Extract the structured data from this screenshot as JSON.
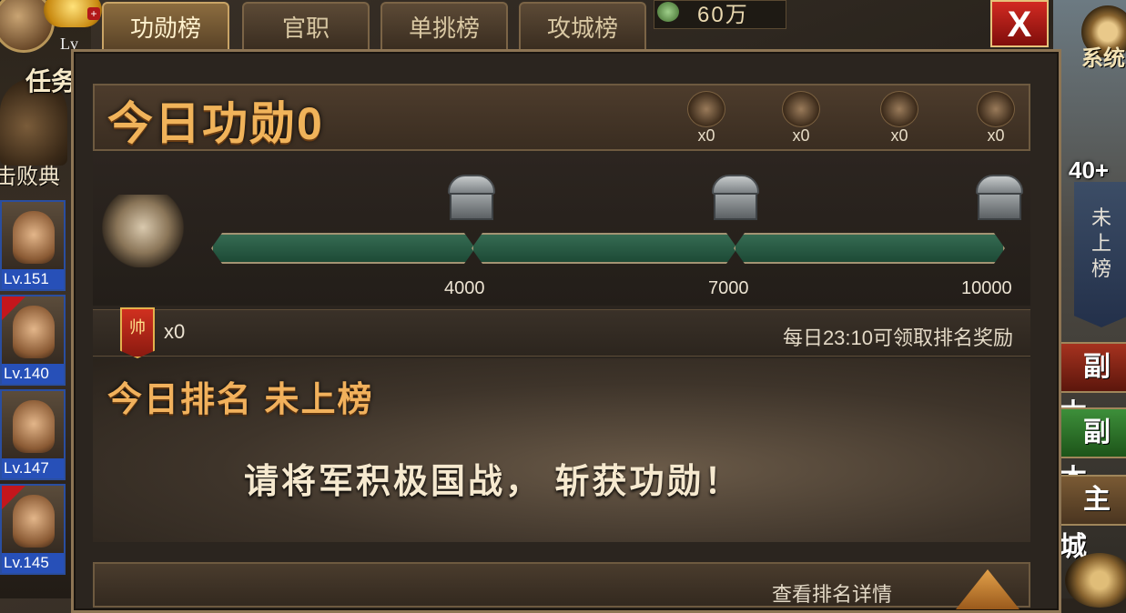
{
  "top_tabs": [
    {
      "label": "功勋榜",
      "active": true
    },
    {
      "label": "官职",
      "active": false
    },
    {
      "label": "单挑榜",
      "active": false
    },
    {
      "label": "攻城榜",
      "active": false
    }
  ],
  "resource": {
    "value": "60万",
    "icon": "jade-icon"
  },
  "close_label": "X",
  "left_sidebar": {
    "level_prefix": "Lv",
    "task_label": "任务",
    "defeat_label": "击败典",
    "heroes": [
      {
        "level": "Lv.151"
      },
      {
        "level": "Lv.140"
      },
      {
        "level": "Lv.147"
      },
      {
        "level": "Lv.145"
      }
    ]
  },
  "right_sidebar": {
    "system_label": "系统",
    "count_label": "40+",
    "banner_text": "未上榜",
    "buttons": [
      "副本",
      "副本",
      "主城"
    ]
  },
  "merit": {
    "title": "今日功勋0",
    "stats": [
      {
        "icon": "soldier-icon",
        "count": "x0"
      },
      {
        "icon": "fortress-icon",
        "count": "x0"
      },
      {
        "icon": "general-pair-icon",
        "count": "x0"
      },
      {
        "icon": "banner-icon",
        "count": "x0"
      }
    ]
  },
  "progress": {
    "current": 0,
    "milestones": [
      {
        "value": "4000",
        "icon": "chest-icon"
      },
      {
        "value": "7000",
        "icon": "chest-icon"
      },
      {
        "value": "10000",
        "icon": "chest-icon"
      }
    ]
  },
  "flag": {
    "glyph": "帅",
    "count": "x0"
  },
  "reward_tip": "每日23:10可领取排名奖励",
  "ranking": {
    "title": "今日排名 未上榜",
    "message": "请将军积极国战， 斩获功勋！"
  },
  "footer": {
    "detail_link": "查看排名详情"
  },
  "colors": {
    "accent": "#f0b35a",
    "bar": "#356b52",
    "close": "#d22a22"
  }
}
